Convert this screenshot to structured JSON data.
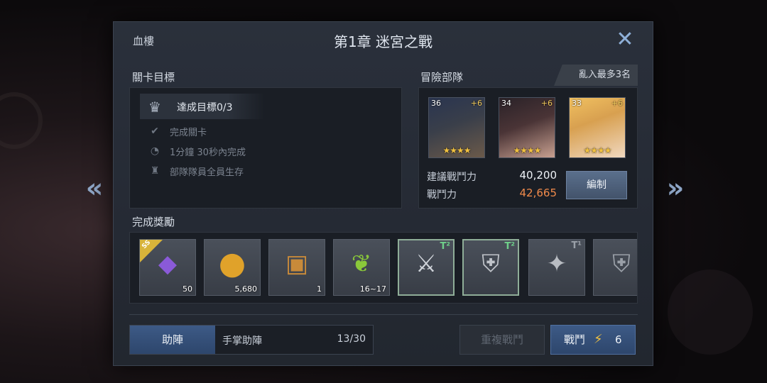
{
  "header": {
    "location": "血樓",
    "title": "第1章 迷宮之戰",
    "close_icon": "close-icon"
  },
  "objectives": {
    "section_label": "關卡目標",
    "summary": "達成目標0/3",
    "items": [
      {
        "icon": "check-icon",
        "text": "完成關卡"
      },
      {
        "icon": "timer-icon",
        "text": "1分鐘 30秒內完成"
      },
      {
        "icon": "party-icon",
        "text": "部隊隊員全員生存"
      }
    ]
  },
  "team": {
    "section_label": "冒險部隊",
    "tag": "亂入最多3名",
    "heroes": [
      {
        "level": "36",
        "plus": "+6",
        "stars": 4,
        "color": "#3a3f4a"
      },
      {
        "level": "34",
        "plus": "+6",
        "stars": 4,
        "color": "#4a3436"
      },
      {
        "level": "33",
        "plus": "+6",
        "stars": 4,
        "color": "#8a6a3a"
      }
    ],
    "recommended_label": "建議戰鬥力",
    "recommended_value": "40,200",
    "power_label": "戰鬥力",
    "power_value": "42,665",
    "power_color": "#f08a4b",
    "edit_label": "編制"
  },
  "rewards": {
    "section_label": "完成獎勵",
    "items": [
      {
        "name": "purple-crystal",
        "glyph": "◆",
        "color": "#8a5ad8",
        "qty": "50",
        "badge": "SS",
        "tier": ""
      },
      {
        "name": "gold-coin",
        "glyph": "●",
        "color": "#e0a22a",
        "qty": "5,680",
        "badge": "",
        "tier": ""
      },
      {
        "name": "treasure-chest",
        "glyph": "▣",
        "color": "#c88a3a",
        "qty": "1",
        "badge": "",
        "tier": ""
      },
      {
        "name": "green-sprout",
        "glyph": "❦",
        "color": "#8ac83a",
        "qty": "16~17",
        "badge": "",
        "tier": ""
      },
      {
        "name": "curved-blade",
        "glyph": "⚔",
        "color": "#d0d4da",
        "qty": "",
        "badge": "",
        "tier": "T²",
        "tier_color": "#6fd08a",
        "selected": true
      },
      {
        "name": "chest-armor",
        "glyph": "⛨",
        "color": "#c0c4ca",
        "qty": "",
        "badge": "",
        "tier": "T²",
        "tier_color": "#6fd08a",
        "selected": true
      },
      {
        "name": "spiked-mace",
        "glyph": "✦",
        "color": "#b8bcc2",
        "qty": "",
        "badge": "",
        "tier": "T¹",
        "tier_color": "#9aa0a8"
      },
      {
        "name": "plate-armor",
        "glyph": "⛨",
        "color": "#9aa0a8",
        "qty": "",
        "badge": "",
        "tier": ""
      }
    ]
  },
  "footer": {
    "assist_label": "助陣",
    "assist_name": "手掌助陣",
    "assist_count": "13/30",
    "repeat_label": "重複戰鬥",
    "battle_label": "戰鬥",
    "battle_cost": "6"
  }
}
